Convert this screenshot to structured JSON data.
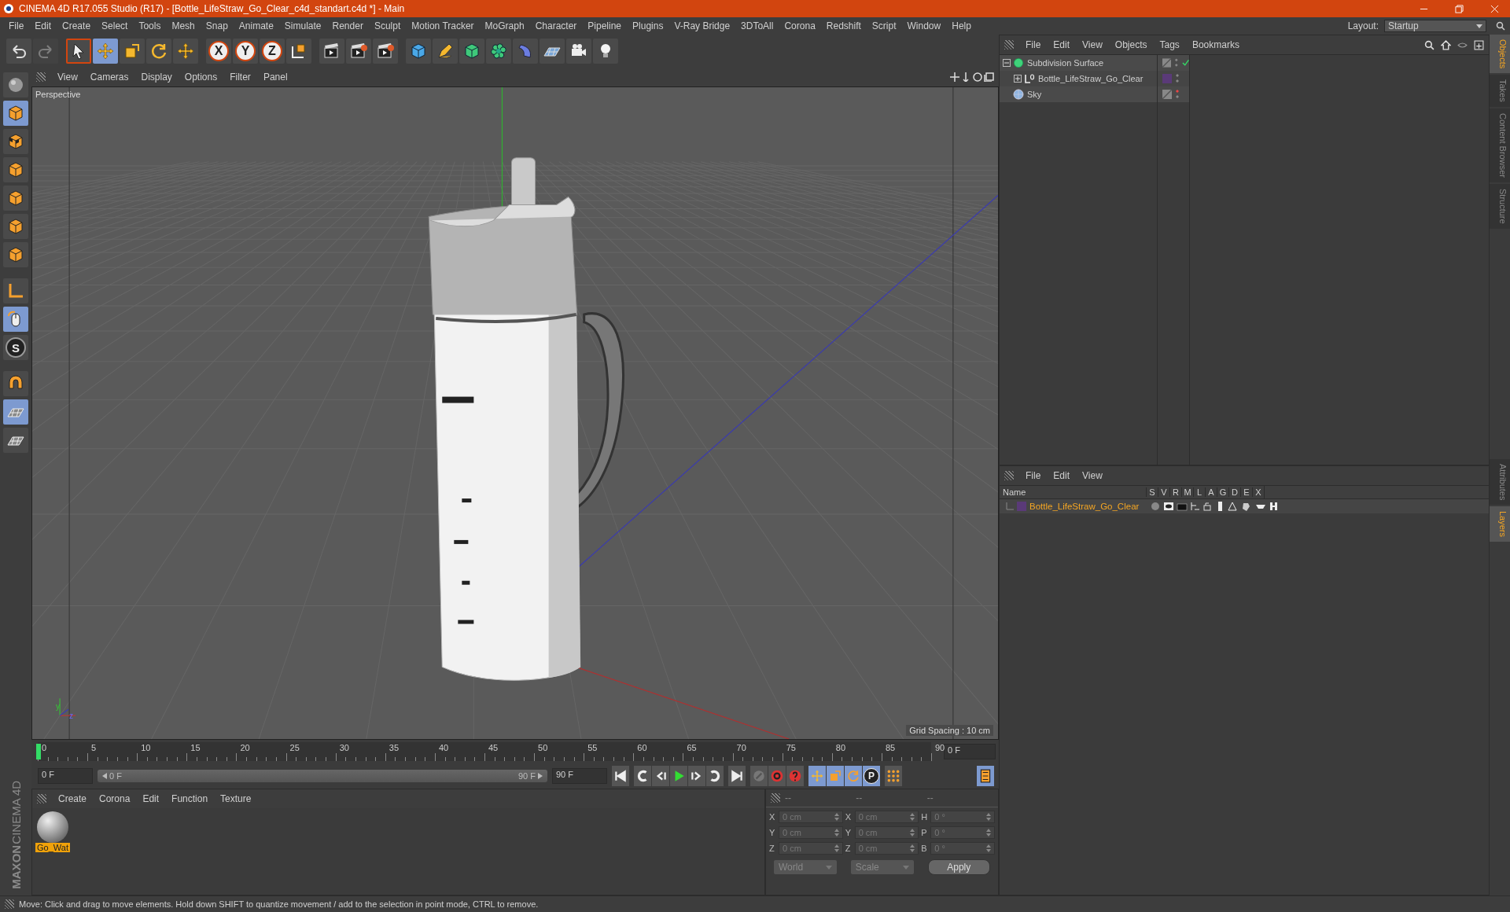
{
  "window": {
    "title": "CINEMA 4D R17.055 Studio (R17) - [Bottle_LifeStraw_Go_Clear_c4d_standart.c4d *] - Main"
  },
  "menu_bar": [
    "File",
    "Edit",
    "Create",
    "Select",
    "Tools",
    "Mesh",
    "Snap",
    "Animate",
    "Simulate",
    "Render",
    "Sculpt",
    "Motion Tracker",
    "MoGraph",
    "Character",
    "Pipeline",
    "Plugins",
    "V-Ray Bridge",
    "3DToAll",
    "Corona",
    "Redshift",
    "Script",
    "Window",
    "Help"
  ],
  "layout": {
    "label": "Layout:",
    "value": "Startup"
  },
  "toolbar": {
    "axis_buttons": [
      "X",
      "Y",
      "Z"
    ]
  },
  "left_toolbar": {
    "snap_label": "S"
  },
  "viewport": {
    "menu": [
      "View",
      "Cameras",
      "Display",
      "Options",
      "Filter",
      "Panel"
    ],
    "camera_label": "Perspective",
    "grid_spacing": "Grid Spacing : 10 cm",
    "axis_labels": [
      "y",
      "z"
    ]
  },
  "timeline": {
    "ticks": [
      "0",
      "5",
      "10",
      "15",
      "20",
      "25",
      "30",
      "35",
      "40",
      "45",
      "50",
      "55",
      "60",
      "65",
      "70",
      "75",
      "80",
      "85",
      "90"
    ],
    "playhead": {
      "level": 0
    },
    "current_frame": "0 F",
    "start_field": "0 F",
    "range_start": "0 F",
    "range_end": "90 F",
    "end_field": "90 F",
    "key_label": "P"
  },
  "material_manager": {
    "menu": [
      "Create",
      "Corona",
      "Edit",
      "Function",
      "Texture"
    ],
    "materials": [
      {
        "name": "Go_Wat",
        "selected": true
      }
    ]
  },
  "coordinates": {
    "headers": [
      "--",
      "--",
      "--"
    ],
    "rows": [
      {
        "axis": "X",
        "position": "0 cm",
        "size_axis": "X",
        "size": "0 cm",
        "rotation_axis": "H",
        "rotation": "0 °"
      },
      {
        "axis": "Y",
        "position": "0 cm",
        "size_axis": "Y",
        "size": "0 cm",
        "rotation_axis": "P",
        "rotation": "0 °"
      },
      {
        "axis": "Z",
        "position": "0 cm",
        "size_axis": "Z",
        "size": "0 cm",
        "rotation_axis": "B",
        "rotation": "0 °"
      }
    ],
    "mode_dropdown": "World",
    "size_dropdown": "Scale",
    "apply": "Apply"
  },
  "object_manager": {
    "menu": [
      "File",
      "Edit",
      "View",
      "Objects",
      "Tags",
      "Bookmarks"
    ],
    "objects": [
      {
        "name": "Subdivision Surface",
        "kind": "subdivision",
        "expanded": true,
        "checked": true,
        "render_off": false,
        "children": [
          {
            "name": "Bottle_LifeStraw_Go_Clear",
            "kind": "null",
            "expanded": false,
            "checked": false,
            "render_off": false,
            "color": "#5a3a78"
          }
        ]
      },
      {
        "name": "Sky",
        "kind": "sky",
        "checked": false,
        "render_off": true
      }
    ]
  },
  "layer_manager": {
    "menu": [
      "File",
      "Edit",
      "View"
    ],
    "columns": [
      "Name",
      "S",
      "V",
      "R",
      "M",
      "L",
      "A",
      "G",
      "D",
      "E",
      "X"
    ],
    "layers": [
      {
        "name": "Bottle_LifeStraw_Go_Clear",
        "color": "#5a3a78"
      }
    ]
  },
  "side_tabs": {
    "top": [
      {
        "label": "Objects",
        "selected": true
      },
      {
        "label": "Takes",
        "selected": false
      },
      {
        "label": "Content Browser",
        "selected": false
      },
      {
        "label": "Structure",
        "selected": false
      }
    ],
    "bottom": [
      {
        "label": "Attributes",
        "selected": false
      },
      {
        "label": "Layers",
        "selected": true
      }
    ]
  },
  "logo": {
    "brand": "MAXON",
    "product": "CINEMA 4D"
  },
  "status_bar": "Move: Click and drag to move elements. Hold down SHIFT to quantize movement / add to the selection in point mode, CTRL to remove."
}
